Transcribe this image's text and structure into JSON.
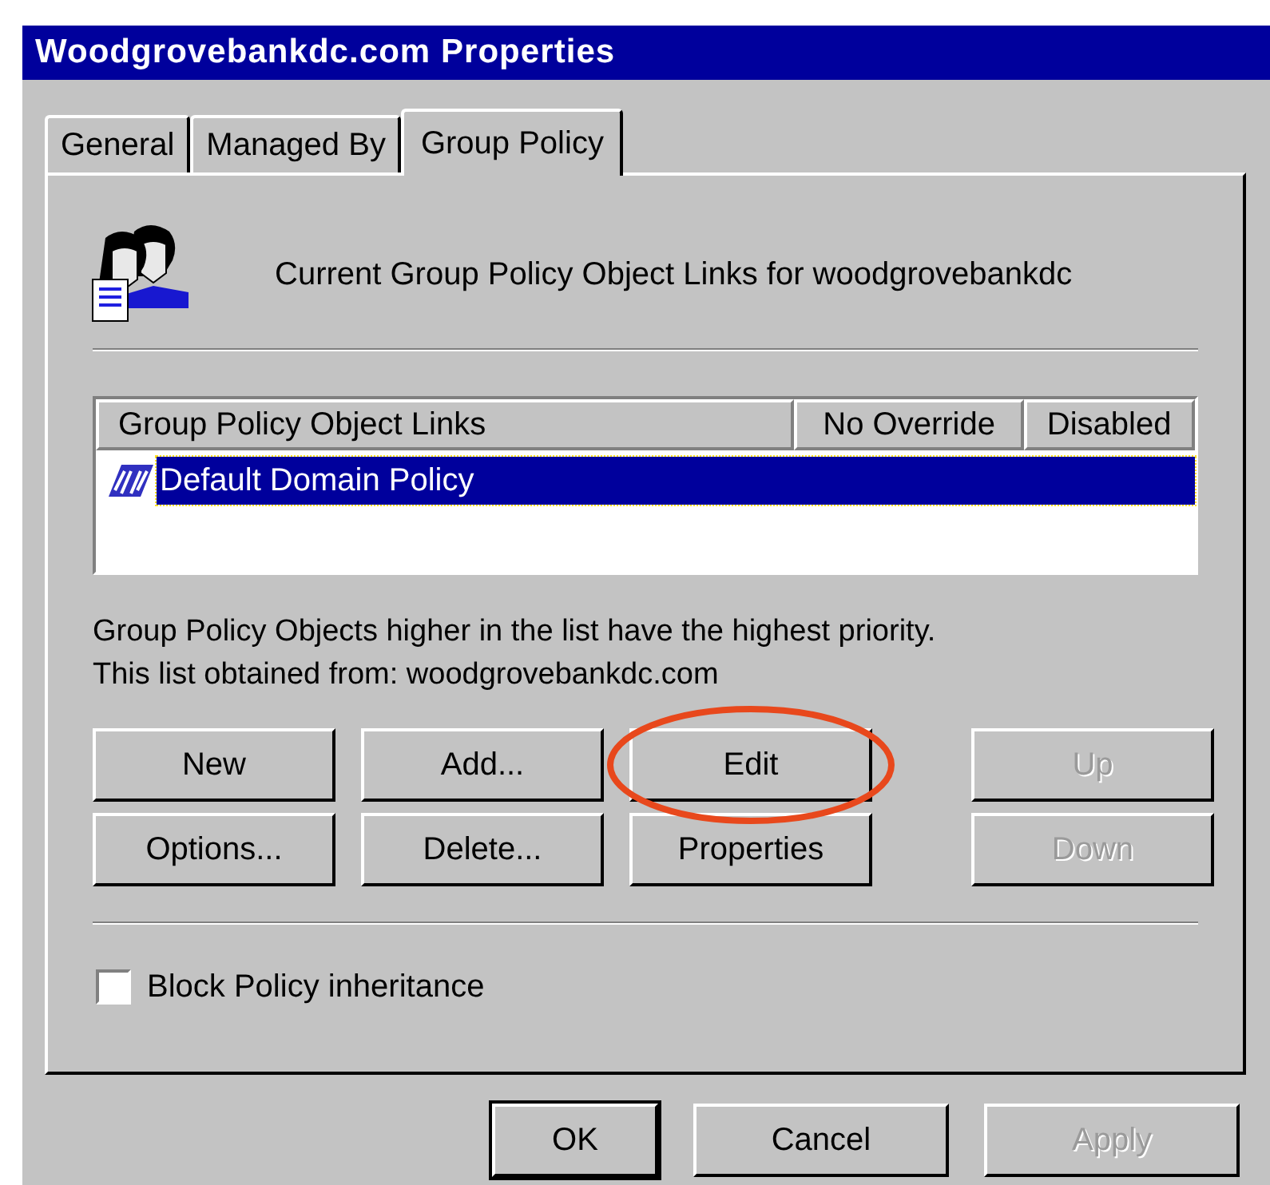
{
  "window": {
    "title": "Woodgrovebankdc.com Properties"
  },
  "tabs": [
    {
      "label": "General",
      "selected": false
    },
    {
      "label": "Managed By",
      "selected": false
    },
    {
      "label": "Group Policy",
      "selected": true
    }
  ],
  "header": {
    "text": "Current Group Policy Object Links for woodgrovebankdc"
  },
  "table": {
    "columns": [
      "Group Policy Object Links",
      "No Override",
      "Disabled"
    ],
    "rows": [
      {
        "name": "Default Domain Policy",
        "selected": true
      }
    ]
  },
  "notes": [
    "Group Policy Objects higher in the list have the highest priority.",
    "This list obtained from: woodgrovebankdc.com"
  ],
  "buttons": [
    {
      "label": "New",
      "disabled": false,
      "circled": false
    },
    {
      "label": "Add...",
      "disabled": false,
      "circled": false
    },
    {
      "label": "Edit",
      "disabled": false,
      "circled": true
    },
    {
      "label": "Up",
      "disabled": true,
      "circled": false
    },
    {
      "label": "Options...",
      "disabled": false,
      "circled": false
    },
    {
      "label": "Delete...",
      "disabled": false,
      "circled": false
    },
    {
      "label": "Properties",
      "disabled": false,
      "circled": false
    },
    {
      "label": "Down",
      "disabled": true,
      "circled": false
    }
  ],
  "block_inheritance": {
    "label": "Block Policy inheritance",
    "checked": false
  },
  "dialog_buttons": [
    {
      "label": "OK",
      "disabled": false,
      "default": true
    },
    {
      "label": "Cancel",
      "disabled": false,
      "default": false
    },
    {
      "label": "Apply",
      "disabled": true,
      "default": false
    }
  ]
}
